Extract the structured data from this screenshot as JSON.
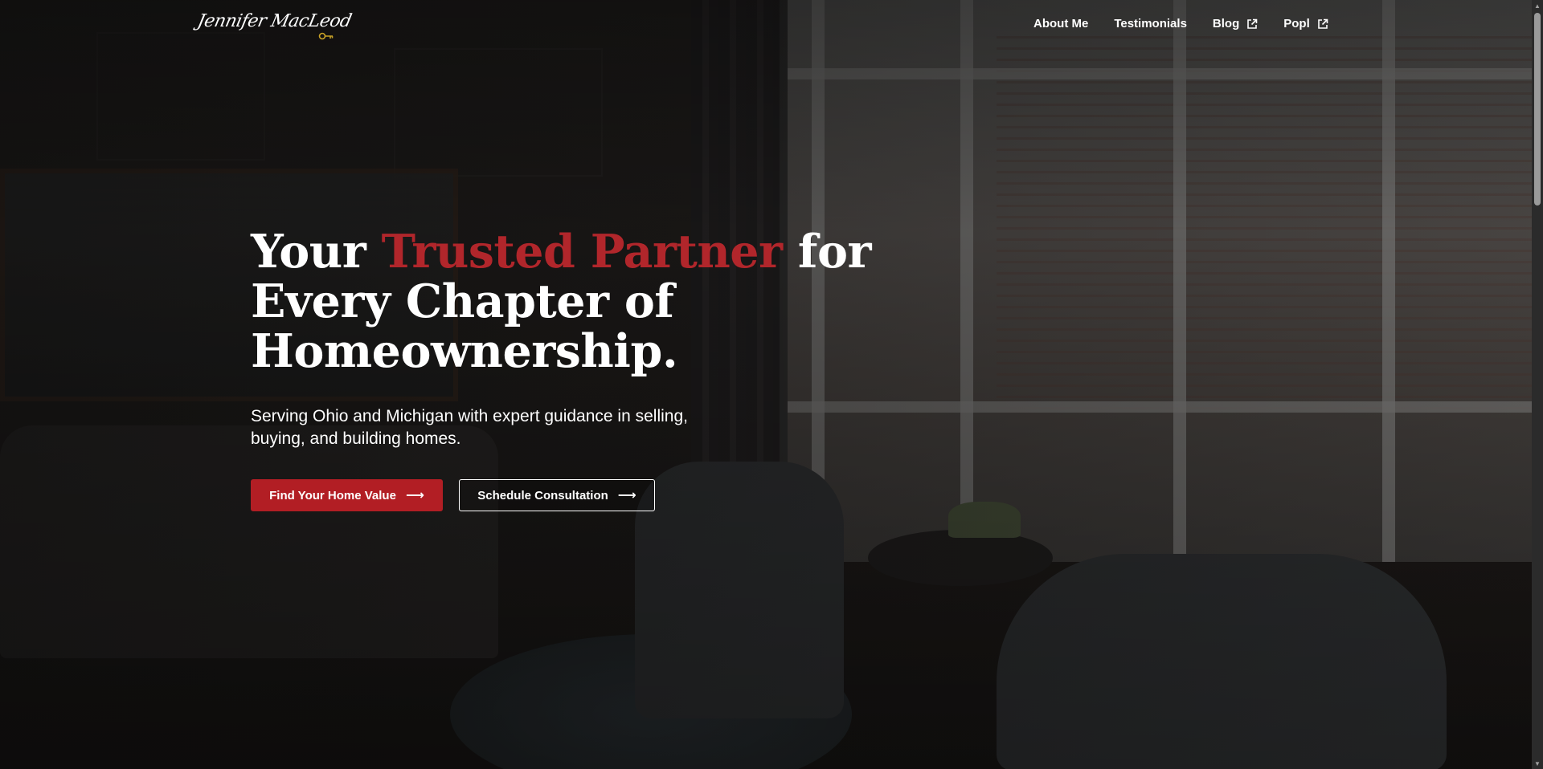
{
  "header": {
    "logo_text": "Jennifer MacLeod",
    "nav": [
      {
        "label": "About Me",
        "external": false
      },
      {
        "label": "Testimonials",
        "external": false
      },
      {
        "label": "Blog",
        "external": true
      },
      {
        "label": "Popl",
        "external": true
      }
    ]
  },
  "hero": {
    "headline_part1": "Your ",
    "headline_accent": "Trusted Partner",
    "headline_part2": " for Every Chapter of Homeownership.",
    "subtitle": "Serving Ohio and Michigan with expert guidance in selling, buying, and building homes.",
    "primary_button": "Find Your Home Value",
    "secondary_button": "Schedule Consultation",
    "arrow": "⟶"
  },
  "colors": {
    "accent": "#b1262b",
    "button_primary": "#b21e24",
    "text": "#ffffff"
  },
  "icons": {
    "external_link": "external-link-icon",
    "arrow": "arrow-right-icon"
  }
}
